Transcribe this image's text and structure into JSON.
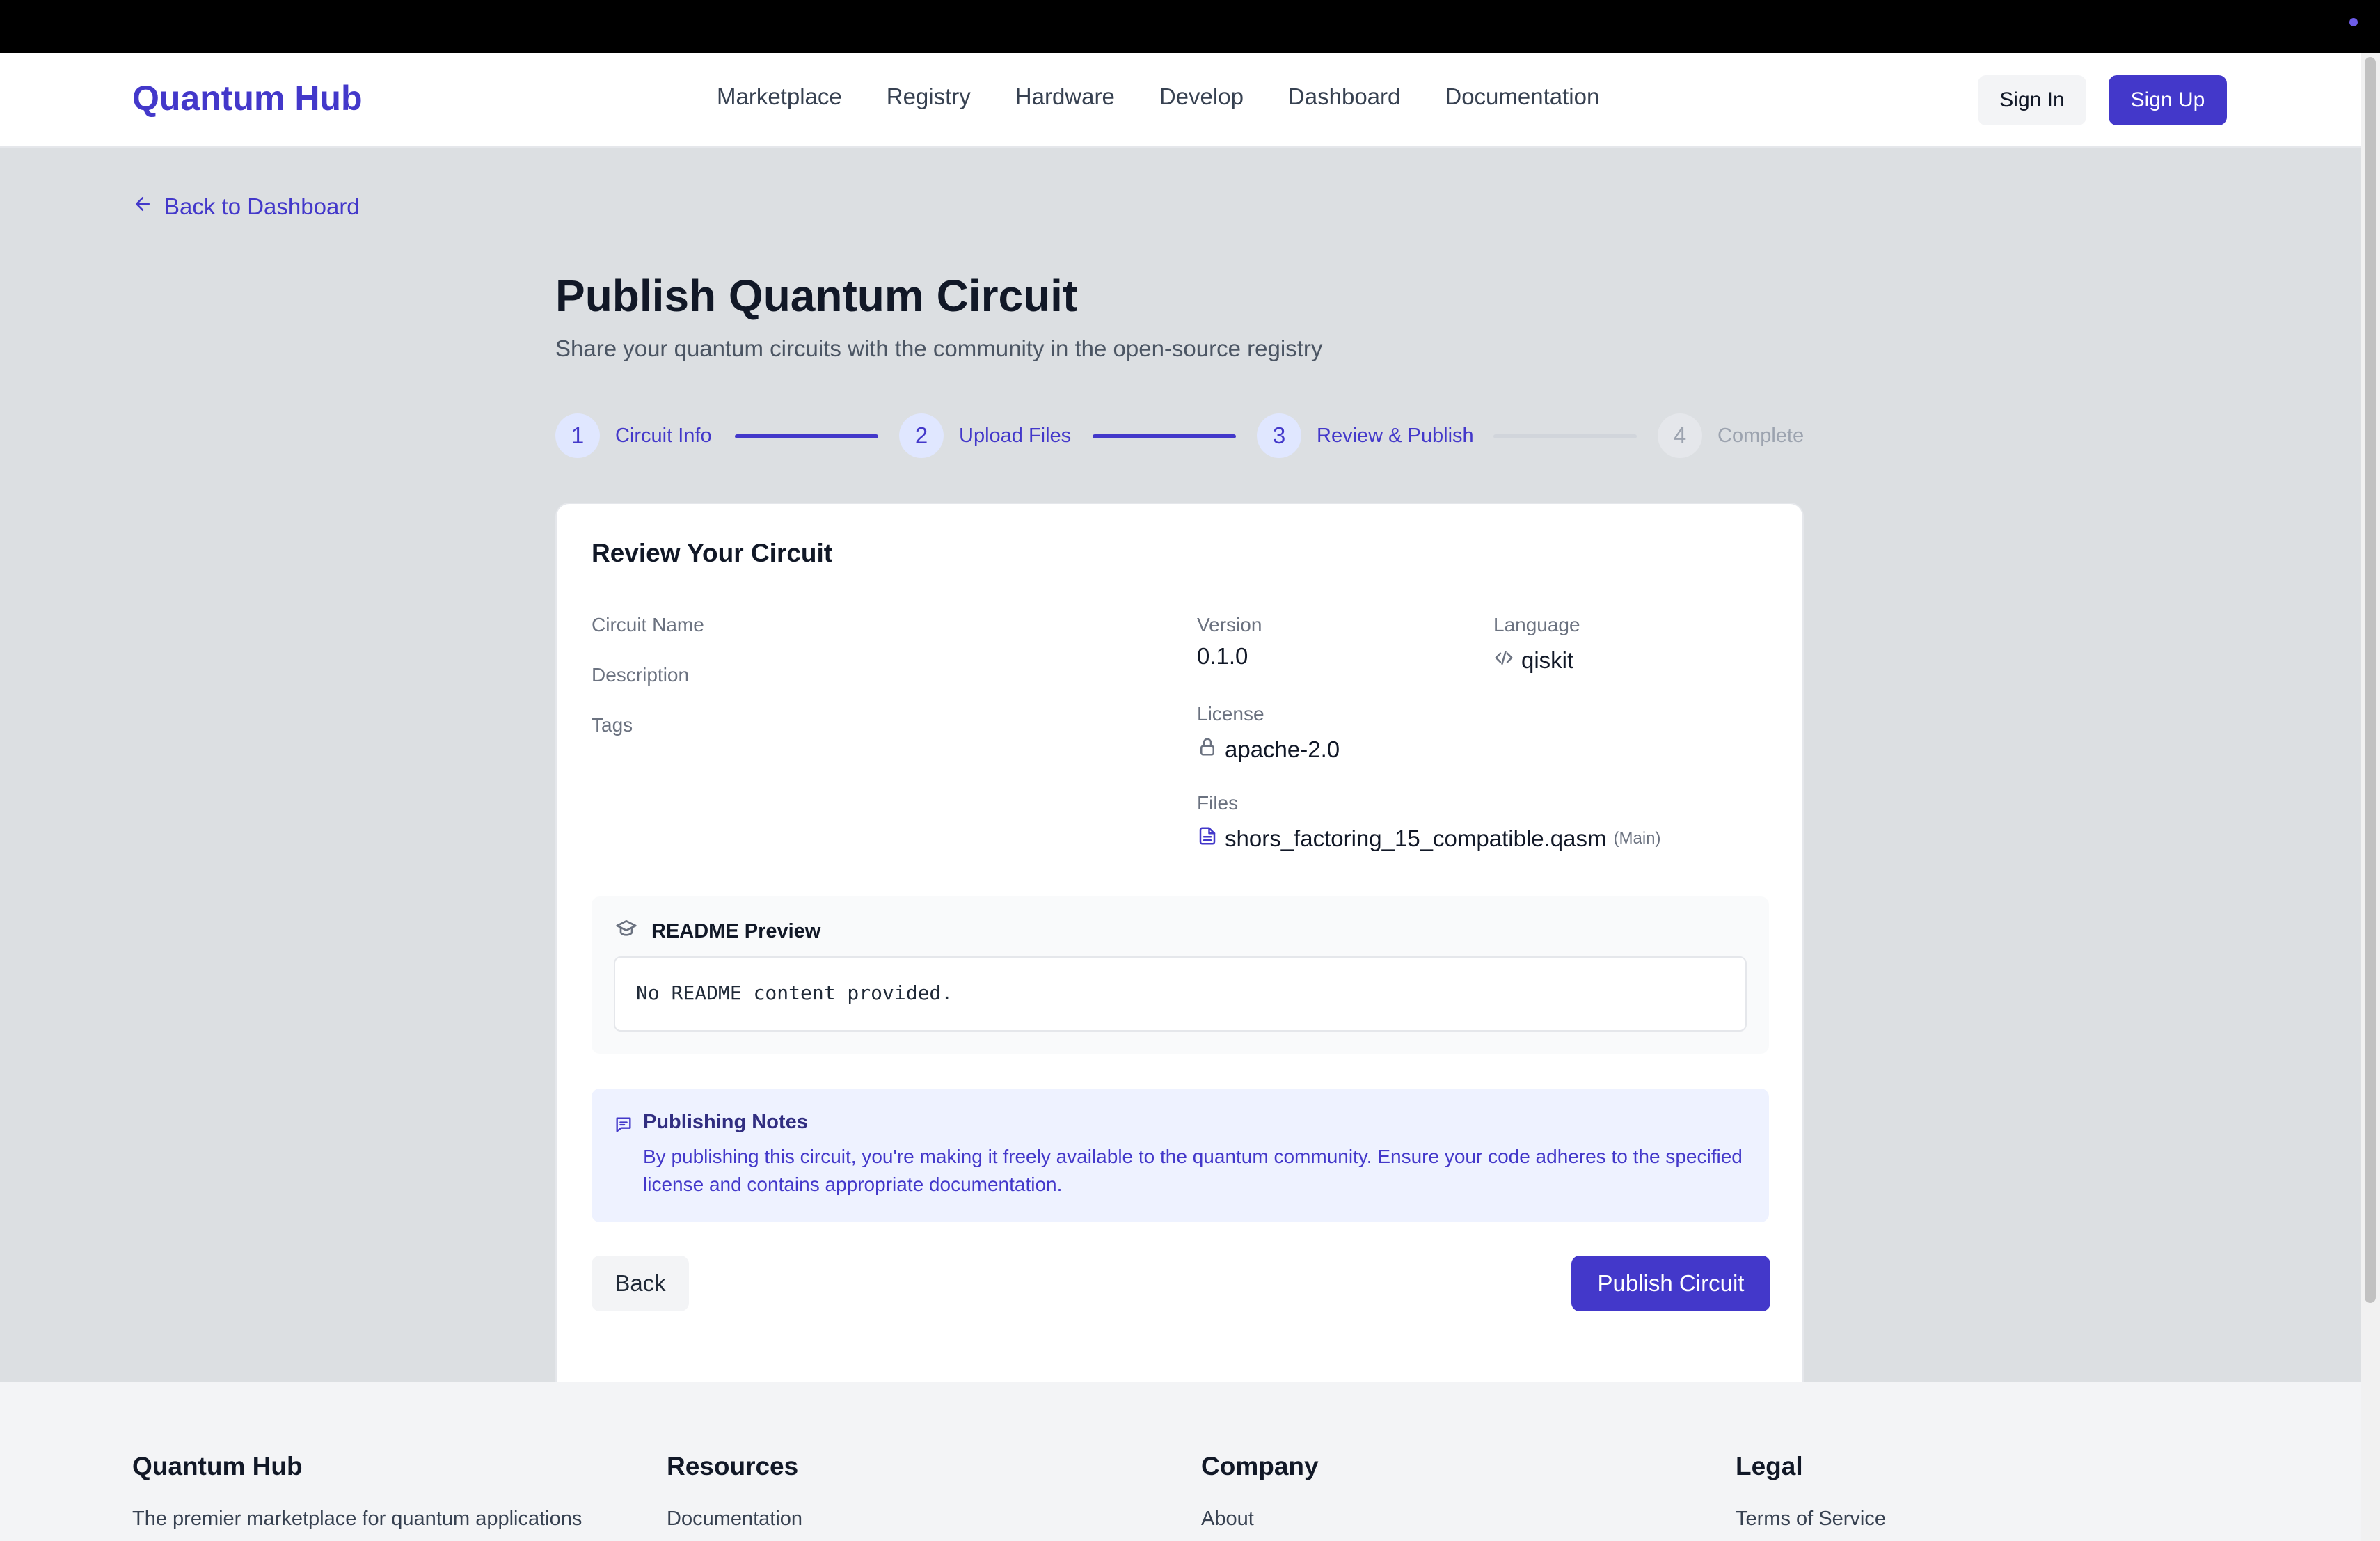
{
  "header": {
    "logo": "Quantum Hub",
    "nav": [
      "Marketplace",
      "Registry",
      "Hardware",
      "Develop",
      "Dashboard",
      "Documentation"
    ],
    "sign_in": "Sign In",
    "sign_up": "Sign Up"
  },
  "back_link": "Back to Dashboard",
  "page": {
    "title": "Publish Quantum Circuit",
    "subtitle": "Share your quantum circuits with the community in the open-source registry"
  },
  "steps": [
    {
      "num": "1",
      "label": "Circuit Info",
      "state": "active"
    },
    {
      "num": "2",
      "label": "Upload Files",
      "state": "active"
    },
    {
      "num": "3",
      "label": "Review & Publish",
      "state": "active"
    },
    {
      "num": "4",
      "label": "Complete",
      "state": "todo"
    }
  ],
  "review": {
    "title": "Review Your Circuit",
    "labels": {
      "circuit_name": "Circuit Name",
      "description": "Description",
      "tags": "Tags",
      "version": "Version",
      "language": "Language",
      "license": "License",
      "files": "Files"
    },
    "version": "0.1.0",
    "language": "qiskit",
    "license": "apache-2.0",
    "file_name": "shors_factoring_15_compatible.qasm",
    "file_tag": "(Main)"
  },
  "readme": {
    "title": "README Preview",
    "content": "No README content provided."
  },
  "notes": {
    "title": "Publishing Notes",
    "text": "By publishing this circuit, you're making it freely available to the quantum community. Ensure your code adheres to the specified license and contains appropriate documentation."
  },
  "actions": {
    "back": "Back",
    "publish": "Publish Circuit"
  },
  "footer": {
    "brand": "Quantum Hub",
    "brand_text": "The premier marketplace for quantum applications",
    "resources_title": "Resources",
    "resources_first": "Documentation",
    "company_title": "Company",
    "company_first": "About",
    "legal_title": "Legal",
    "legal_first": "Terms of Service"
  },
  "colors": {
    "accent": "#4338ca",
    "accent_light": "#e0e7ff"
  }
}
